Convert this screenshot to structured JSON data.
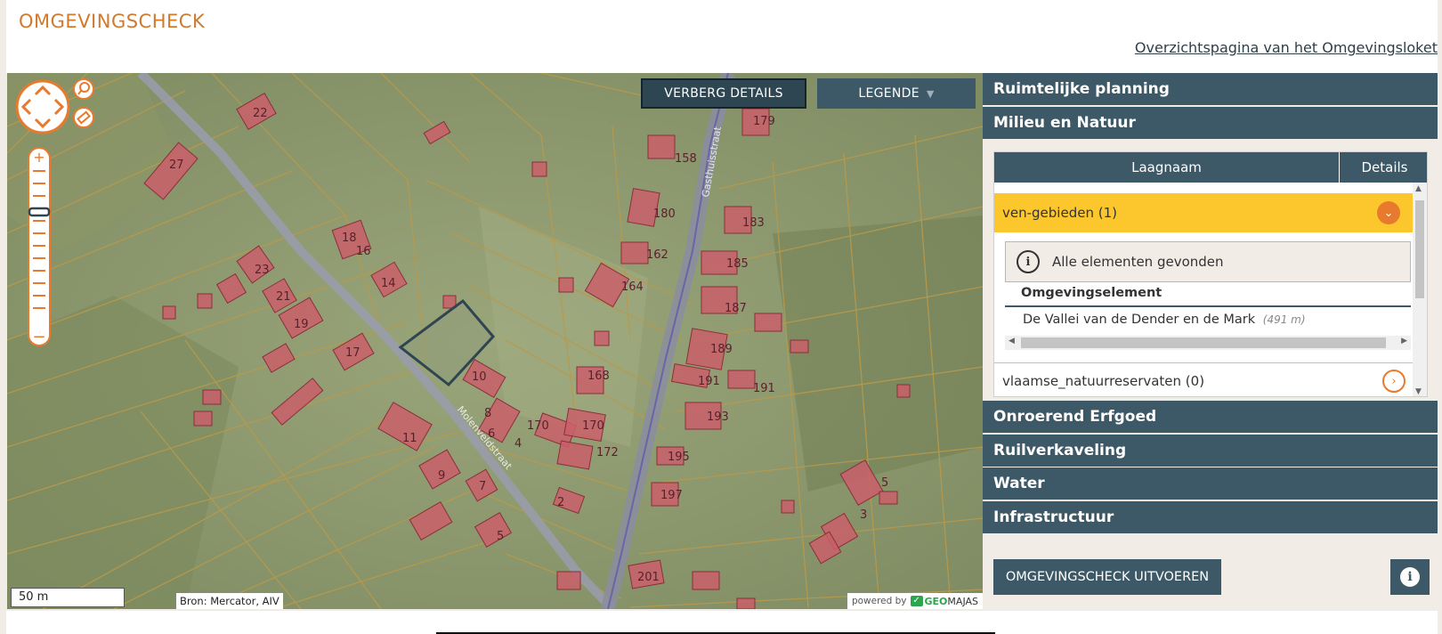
{
  "header": {
    "title": "OMGEVINGSCHECK",
    "overview_link": "Overzichtspagina van het Omgevingsloket"
  },
  "map": {
    "buttons": {
      "hide_details": "VERBERG DETAILS",
      "legend": "LEGENDE"
    },
    "scale": "50 m",
    "source": "Bron: Mercator, AIV",
    "powered_by": "powered by",
    "brand_part1": "GEO",
    "brand_part2": "MAJAS",
    "street_labels": [
      "Gasthuisstraat",
      "Molenveldstraat"
    ],
    "house_numbers": [
      "22",
      "27",
      "18",
      "16",
      "23",
      "21",
      "19",
      "14",
      "17",
      "10",
      "8",
      "6",
      "4",
      "170",
      "170",
      "172",
      "168",
      "11",
      "9",
      "7",
      "2",
      "5",
      "179",
      "158",
      "180",
      "162",
      "164",
      "183",
      "185",
      "187",
      "189",
      "191",
      "191",
      "193",
      "195",
      "197",
      "201",
      "5",
      "3"
    ],
    "colors": {
      "parcel_line": "#b89a4c",
      "building": "#c95f6a",
      "selected_parcel": "#2f4550",
      "road": "#8a8da0"
    }
  },
  "panel": {
    "categories_top": [
      "Ruimtelijke planning",
      "Milieu en Natuur"
    ],
    "categories_bottom": [
      "Onroerend Erfgoed",
      "Ruilverkaveling",
      "Water",
      "Infrastructuur"
    ],
    "table": {
      "col_name": "Laagnaam",
      "col_details": "Details",
      "selected_row": "ven-gebieden (1)",
      "info_text": "Alle elementen gevonden",
      "sub_header": "Omgevingselement",
      "element_name": "De Vallei van de Dender en de Mark",
      "element_distance": "(491 m)",
      "next_row": "vlaamse_natuurreservaten (0)"
    },
    "run_button": "OMGEVINGSCHECK UITVOEREN",
    "colors": {
      "header_bg": "#3d5866",
      "selected_row": "#fcc72c",
      "accent": "#e87a2d"
    }
  }
}
